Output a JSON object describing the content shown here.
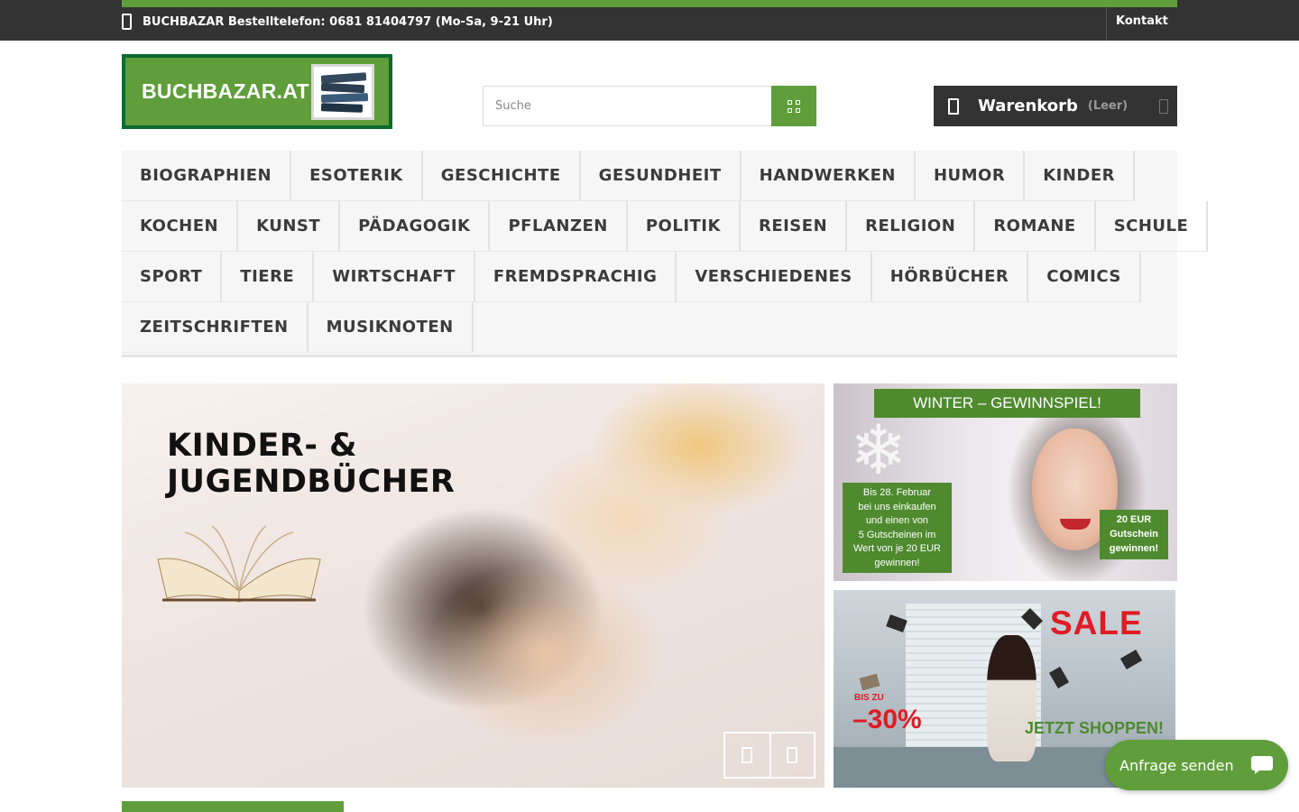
{
  "topbar": {
    "phone_text": "BUCHBAZAR Bestelltelefon: 0681 81404797 (Mo-Sa, 9-21 Uhr)",
    "contact_label": "Kontakt"
  },
  "header": {
    "logo_text": "BUCHBAZAR.AT",
    "search": {
      "placeholder": "Suche"
    },
    "cart": {
      "label": "Warenkorb",
      "count_label": "(Leer)"
    }
  },
  "menu": {
    "rows": [
      [
        "BIOGRAPHIEN",
        "ESOTERIK",
        "GESCHICHTE",
        "GESUNDHEIT",
        "HANDWERKEN",
        "HUMOR",
        "KINDER"
      ],
      [
        "KOCHEN",
        "KUNST",
        "PÄDAGOGIK",
        "PFLANZEN",
        "POLITIK",
        "REISEN",
        "RELIGION",
        "ROMANE",
        "SCHULE"
      ],
      [
        "SPORT",
        "TIERE",
        "WIRTSCHAFT",
        "FREMDSPRACHIG",
        "VERSCHIEDENES",
        "HÖRBÜCHER",
        "COMICS"
      ],
      [
        "ZEITSCHRIFTEN",
        "MUSIKNOTEN"
      ]
    ]
  },
  "hero": {
    "title_line1": "KINDER- &",
    "title_line2": "JUGENDBÜCHER"
  },
  "banner_winter": {
    "heading": "WINTER – GEWINNSPIEL!",
    "note_lines": [
      "Bis 28. Februar",
      "bei uns einkaufen",
      "und einen von",
      "5 Gutscheinen im",
      "Wert von je 20 EUR",
      "gewinnen!"
    ],
    "prize_lines": [
      "20 EUR",
      "Gutschein",
      "gewinnen!"
    ]
  },
  "banner_sale": {
    "sale": "SALE",
    "bis": "BIS ZU",
    "percent": "–30%",
    "cta": "JETZT SHOPPEN!"
  },
  "chat": {
    "label": "Anfrage senden"
  },
  "colors": {
    "brand_green": "#5f9e3a",
    "dark_bar": "#333333",
    "sale_red": "#e01b24"
  }
}
